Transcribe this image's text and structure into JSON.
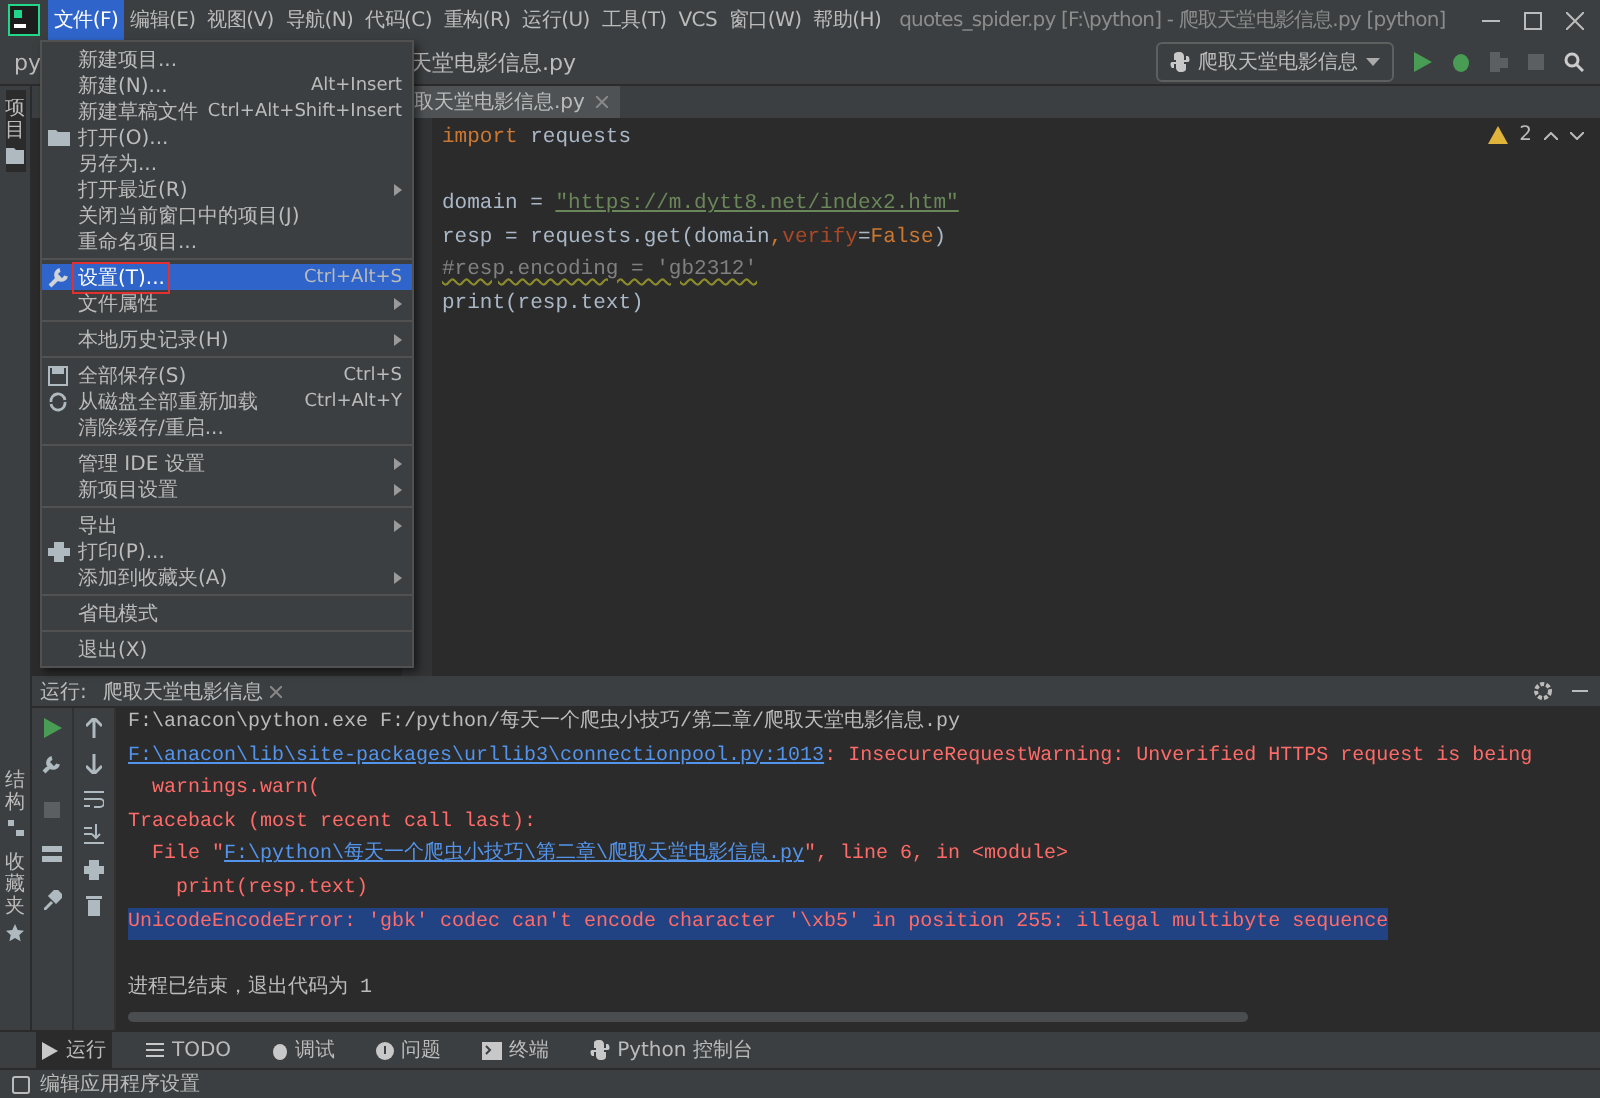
{
  "window": {
    "title": "quotes_spider.py [F:\\python] - 爬取天堂电影信息.py [python]"
  },
  "menu_bar": [
    {
      "label": "文件(F)",
      "selected": true
    },
    {
      "label": "编辑(E)",
      "selected": false
    },
    {
      "label": "视图(V)",
      "selected": false
    },
    {
      "label": "导航(N)",
      "selected": false
    },
    {
      "label": "代码(C)",
      "selected": false
    },
    {
      "label": "重构(R)",
      "selected": false
    },
    {
      "label": "运行(U)",
      "selected": false
    },
    {
      "label": "工具(T)",
      "selected": false
    },
    {
      "label": "VCS",
      "selected": false
    },
    {
      "label": "窗口(W)",
      "selected": false
    },
    {
      "label": "帮助(H)",
      "selected": false
    }
  ],
  "breadcrumb": [
    "py",
    "天堂电影信息.py"
  ],
  "run_config": {
    "label": "爬取天堂电影信息"
  },
  "editor_tab": {
    "label": "取天堂电影信息.py"
  },
  "warnings": {
    "count": "2"
  },
  "code_lines": [
    {
      "tokens": [
        {
          "kind": "keyword",
          "text": "import"
        },
        {
          "kind": "plain",
          "text": " requests"
        }
      ]
    },
    {
      "kind": "blank"
    },
    {
      "tokens": [
        {
          "kind": "plain",
          "text": "domain = "
        },
        {
          "kind": "string",
          "text": "\"https://m.dytt8.net/index2.htm\""
        }
      ]
    },
    {
      "tokens": [
        {
          "kind": "plain",
          "text": "resp = requests.get(domain"
        },
        {
          "kind": "keyword",
          "text": ","
        },
        {
          "kind": "param",
          "text": "verify"
        },
        {
          "kind": "plain",
          "text": "="
        },
        {
          "kind": "keyword",
          "text": "False"
        },
        {
          "kind": "plain",
          "text": ")"
        }
      ]
    },
    {
      "tokens": [
        {
          "kind": "comment",
          "text": "#resp.encoding = 'gb2312'"
        }
      ]
    },
    {
      "tokens": [
        {
          "kind": "plain",
          "text": "print(resp.text)"
        }
      ]
    }
  ],
  "file_menu": [
    {
      "label": "新建项目...",
      "kind": "plain",
      "selected": false
    },
    {
      "label": "新建(N)...",
      "shortcut": "Alt+Insert",
      "kind": "plain",
      "selected": false
    },
    {
      "label": "新建草稿文件",
      "shortcut": "Ctrl+Alt+Shift+Insert",
      "kind": "plain",
      "selected": false
    },
    {
      "label": "打开(O)...",
      "kind": "folder",
      "selected": false
    },
    {
      "label": "另存为...",
      "kind": "plain",
      "selected": false
    },
    {
      "label": "打开最近(R)",
      "submenu": true,
      "kind": "plain",
      "selected": false
    },
    {
      "label": "关闭当前窗口中的项目(J)",
      "kind": "plain",
      "selected": false
    },
    {
      "label": "重命名项目...",
      "kind": "plain",
      "selected": false
    },
    {
      "label": "设置(T)...",
      "shortcut": "Ctrl+Alt+S",
      "kind": "wrench",
      "selected": true,
      "separator_before": true
    },
    {
      "label": "文件属性",
      "submenu": true,
      "kind": "plain",
      "selected": false
    },
    {
      "label": "本地历史记录(H)",
      "submenu": true,
      "kind": "plain",
      "selected": false,
      "separator_before": true
    },
    {
      "label": "全部保存(S)",
      "shortcut": "Ctrl+S",
      "kind": "save",
      "selected": false,
      "separator_before": true
    },
    {
      "label": "从磁盘全部重新加载",
      "shortcut": "Ctrl+Alt+Y",
      "kind": "reload",
      "selected": false
    },
    {
      "label": "清除缓存/重启...",
      "kind": "plain",
      "selected": false
    },
    {
      "label": "管理 IDE 设置",
      "submenu": true,
      "kind": "plain",
      "selected": false,
      "separator_before": true
    },
    {
      "label": "新项目设置",
      "submenu": true,
      "kind": "plain",
      "selected": false
    },
    {
      "label": "导出",
      "submenu": true,
      "kind": "plain",
      "selected": false,
      "separator_before": true
    },
    {
      "label": "打印(P)...",
      "kind": "print",
      "selected": false
    },
    {
      "label": "添加到收藏夹(A)",
      "submenu": true,
      "kind": "plain",
      "selected": false
    },
    {
      "label": "省电模式",
      "kind": "plain",
      "selected": false,
      "separator_before": true
    },
    {
      "label": "退出(X)",
      "kind": "plain",
      "selected": false,
      "separator_before": true
    }
  ],
  "side_tabs": [
    {
      "label": "项目",
      "kind": "folder"
    },
    {
      "label": "结构",
      "kind": "structure"
    },
    {
      "label": "收藏夹",
      "kind": "star"
    }
  ],
  "run_panel": {
    "label": "运行:",
    "tab": "爬取天堂电影信息",
    "console": [
      {
        "selected": false,
        "tokens": [
          {
            "kind": "plain",
            "text": "F:\\anacon\\python.exe F:/python/每天一个爬虫小技巧/第二章/爬取天堂电影信息.py"
          }
        ]
      },
      {
        "selected": false,
        "tokens": [
          {
            "kind": "link",
            "text": "F:\\anacon\\lib\\site-packages\\urllib3\\connectionpool.py:1013"
          },
          {
            "kind": "error",
            "text": ": InsecureRequestWarning: Unverified HTTPS request is being"
          }
        ]
      },
      {
        "selected": false,
        "tokens": [
          {
            "kind": "error",
            "text": "  warnings.warn("
          }
        ]
      },
      {
        "selected": false,
        "tokens": [
          {
            "kind": "error",
            "text": "Traceback (most recent call last):"
          }
        ]
      },
      {
        "selected": false,
        "tokens": [
          {
            "kind": "error",
            "text": "  File \""
          },
          {
            "kind": "link",
            "text": "F:\\python\\每天一个爬虫小技巧\\第二章\\爬取天堂电影信息.py"
          },
          {
            "kind": "error",
            "text": "\", line 6, in <module>"
          }
        ]
      },
      {
        "selected": false,
        "tokens": [
          {
            "kind": "error",
            "text": "    print(resp.text)"
          }
        ]
      },
      {
        "selected": true,
        "tokens": [
          {
            "kind": "error",
            "text": "UnicodeEncodeError: 'gbk' codec can't encode character '\\xb5' in position 255: illegal multibyte sequence"
          }
        ]
      },
      {
        "kind": "blank"
      },
      {
        "selected": false,
        "tokens": [
          {
            "kind": "plain",
            "text": "进程已结束，退出代码为 1"
          }
        ]
      }
    ]
  },
  "tool_tabs": [
    {
      "label": "运行",
      "kind": "run",
      "selected": true
    },
    {
      "label": "TODO",
      "kind": "list",
      "selected": false
    },
    {
      "label": "调试",
      "kind": "bug",
      "selected": false
    },
    {
      "label": "问题",
      "kind": "info",
      "selected": false
    },
    {
      "label": "终端",
      "kind": "terminal",
      "selected": false
    },
    {
      "label": "Python 控制台",
      "kind": "python",
      "selected": false
    }
  ],
  "status_bar": {
    "text": "编辑应用程序设置"
  }
}
